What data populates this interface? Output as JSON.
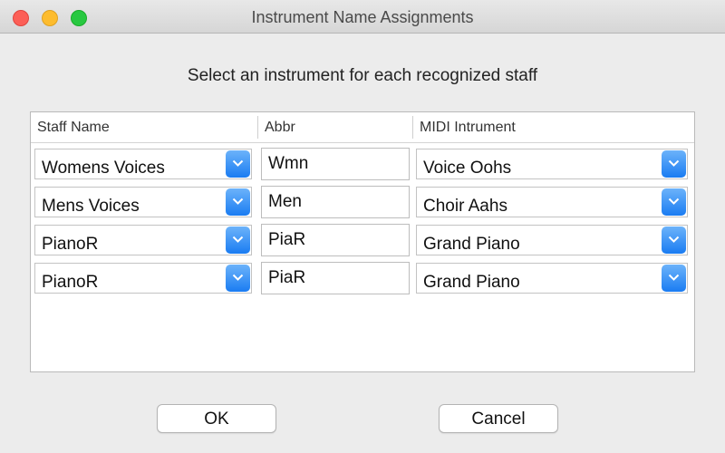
{
  "window": {
    "title": "Instrument Name Assignments"
  },
  "prompt": "Select an instrument for each recognized staff",
  "table": {
    "headers": {
      "staff_name": "Staff Name",
      "abbr": "Abbr",
      "midi": "MIDI Intrument"
    },
    "rows": [
      {
        "staff_name": "Womens Voices",
        "abbr": "Wmn",
        "midi": "Voice Oohs"
      },
      {
        "staff_name": "Mens Voices",
        "abbr": "Men",
        "midi": "Choir Aahs"
      },
      {
        "staff_name": "PianoR",
        "abbr": "PiaR",
        "midi": "Grand Piano"
      },
      {
        "staff_name": "PianoR",
        "abbr": "PiaR",
        "midi": "Grand Piano"
      }
    ]
  },
  "buttons": {
    "ok": "OK",
    "cancel": "Cancel"
  },
  "icons": {
    "dropdown": "chevron-down-icon"
  },
  "colors": {
    "accent": "#1a7cf2",
    "close": "#fc5f57",
    "minimize": "#fdbc2e",
    "zoom": "#28c840"
  }
}
